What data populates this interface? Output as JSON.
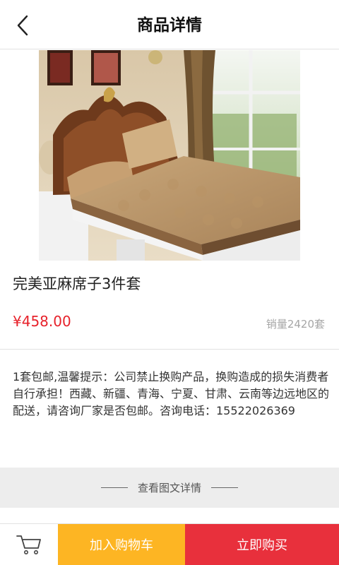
{
  "header": {
    "title": "商品详情",
    "back_icon": "chevron-left-icon"
  },
  "product": {
    "image_alt": "bed-mat-product-photo",
    "title": "完美亚麻席子3件套",
    "price": "¥458.00",
    "sales": "销量2420套",
    "description": "1套包邮,温馨提示：公司禁止换购产品，换购造成的损失消费者自行承担！西藏、新疆、青海、宁夏、甘肃、云南等边远地区的配送，请咨询厂家是否包邮。咨询电话：15522026369"
  },
  "details_link": {
    "label": "查看图文详情"
  },
  "bottom_bar": {
    "cart_icon": "cart-icon",
    "add_to_cart_label": "加入购物车",
    "buy_now_label": "立即购买"
  },
  "colors": {
    "price_red": "#e7222b",
    "add_cart_yellow": "#fdb523",
    "buy_now_red": "#e8303c",
    "band_gray": "#ededed"
  }
}
